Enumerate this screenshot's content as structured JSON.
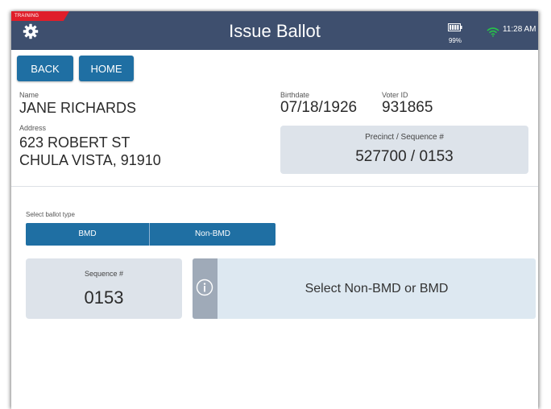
{
  "header": {
    "training_badge": "TRAINING",
    "title": "Issue Ballot",
    "battery_pct": "99%",
    "time": "11:28 AM",
    "colors": {
      "bar": "#3e4f6e",
      "training": "#e01e2a",
      "wifi": "#27c04a"
    }
  },
  "nav": {
    "back_label": "BACK",
    "home_label": "HOME"
  },
  "voter": {
    "name_label": "Name",
    "name": "JANE RICHARDS",
    "address_label": "Address",
    "address_line1": "623 ROBERT  ST",
    "address_line2": "CHULA VISTA, 91910",
    "birthdate_label": "Birthdate",
    "birthdate": "07/18/1926",
    "voter_id_label": "Voter ID",
    "voter_id": "931865",
    "precinct_label": "Precinct / Sequence #",
    "precinct_value": "527700 / 0153"
  },
  "ballot": {
    "select_label": "Select ballot type",
    "options": [
      "BMD",
      "Non-BMD"
    ],
    "sequence_label": "Sequence #",
    "sequence_value": "0153",
    "message": "Select Non-BMD or BMD",
    "accent": "#1f6fa3"
  }
}
